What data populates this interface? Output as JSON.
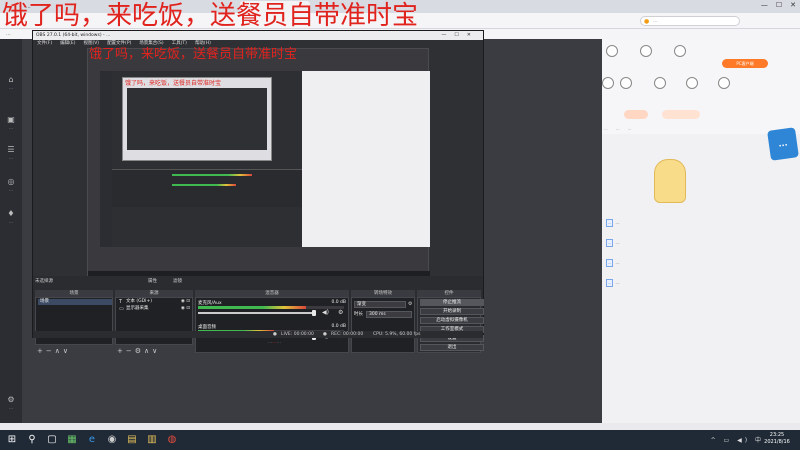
{
  "browser": {
    "tab1": "...",
    "tab2": "...",
    "search_placeholder": "...",
    "bookmarks": "...",
    "window_controls": [
      "—",
      "☐",
      "✕"
    ]
  },
  "overlay_caption": "饿了吗，来吃饭，送餐员自带准时宝",
  "left_sidebar": {
    "items": [
      {
        "icon": "home-icon",
        "label": "...",
        "glyph": "⌂"
      },
      {
        "icon": "video-icon",
        "label": "...",
        "glyph": "▣"
      },
      {
        "icon": "category-icon",
        "label": "...",
        "glyph": "☰"
      },
      {
        "icon": "game-icon",
        "label": "...",
        "glyph": "◎"
      },
      {
        "icon": "trophy-icon",
        "label": "...",
        "glyph": "♦"
      },
      {
        "icon": "settings-icon",
        "label": "...",
        "glyph": "⚙"
      }
    ]
  },
  "obs": {
    "title": "OBS 27.0.1 (64-bit, windows) - ...",
    "menu": [
      "文件(F)",
      "编辑(E)",
      "视图(V)",
      "配置文件(P)",
      "场景集合(S)",
      "工具(T)",
      "帮助(H)"
    ],
    "preview_caption": "饿了吗，来吃饭，送餐员自带准时宝",
    "inner_preview_caption": "饿了吗，来吃饭，送餐员自带准时宝",
    "no_source_label": "未选择源",
    "properties_label": "属性",
    "filters_label": "滤镜",
    "docks": {
      "scenes_header": "场景",
      "sources_header": "来源",
      "mixer_header": "混音器",
      "transitions_header": "转场特效",
      "controls_header": "控件"
    },
    "scenes": [
      "场景"
    ],
    "sources": [
      {
        "icon": "text-icon",
        "glyph": "T",
        "name": "文本 (GDI+)"
      },
      {
        "icon": "display-icon",
        "glyph": "▭",
        "name": "显示器采集"
      }
    ],
    "mixer": [
      {
        "name": "麦克风/Aux",
        "db": "0.0 dB",
        "level": 0.74
      },
      {
        "name": "桌面音频",
        "db": "0.0 dB",
        "level": 0.52
      }
    ],
    "transition": {
      "type": "渐变",
      "duration_label": "时长",
      "duration": "300 ms"
    },
    "controls": [
      "停止推流",
      "开始录制",
      "启动虚拟摄像机",
      "工作室模式",
      "设置",
      "退出"
    ],
    "status": {
      "live": "LIVE: 00:00:00",
      "rec": "REC: 00:00:00",
      "cpu": "CPU: 5.9%, 60.00 fps"
    }
  },
  "page_below_text": {
    "prefix": "...",
    "highlight": "...",
    "suffix": "..."
  },
  "right_panel": {
    "buttons": [
      "PC客户端"
    ],
    "chat": [
      {
        "badge": "...",
        "text": "..."
      },
      {
        "badge": "...",
        "text": "..."
      },
      {
        "badge": "...",
        "text": "..."
      },
      {
        "badge": "...",
        "text": "..."
      }
    ],
    "logo_text": "...",
    "tabs": [
      "...",
      "...",
      "..."
    ]
  },
  "taskbar": {
    "icons": [
      {
        "icon": "windows-start-icon",
        "glyph": "⊞"
      },
      {
        "icon": "search-icon",
        "glyph": "⚲"
      },
      {
        "icon": "task-view-icon",
        "glyph": "▢"
      },
      {
        "icon": "app-icon",
        "glyph": "▦"
      },
      {
        "icon": "edge-icon",
        "glyph": "e"
      },
      {
        "icon": "obs-icon",
        "glyph": "◉"
      },
      {
        "icon": "files-icon",
        "glyph": "▤"
      },
      {
        "icon": "app2-icon",
        "glyph": "▥"
      },
      {
        "icon": "chrome-icon",
        "glyph": "◍"
      }
    ],
    "time": "23:25",
    "date": "2021/8/16"
  },
  "colors": {
    "caption_red": "#e1231e",
    "obs_bg": "#2f3034",
    "taskbar": "#1f2a36",
    "accent_orange": "#f39c12"
  }
}
